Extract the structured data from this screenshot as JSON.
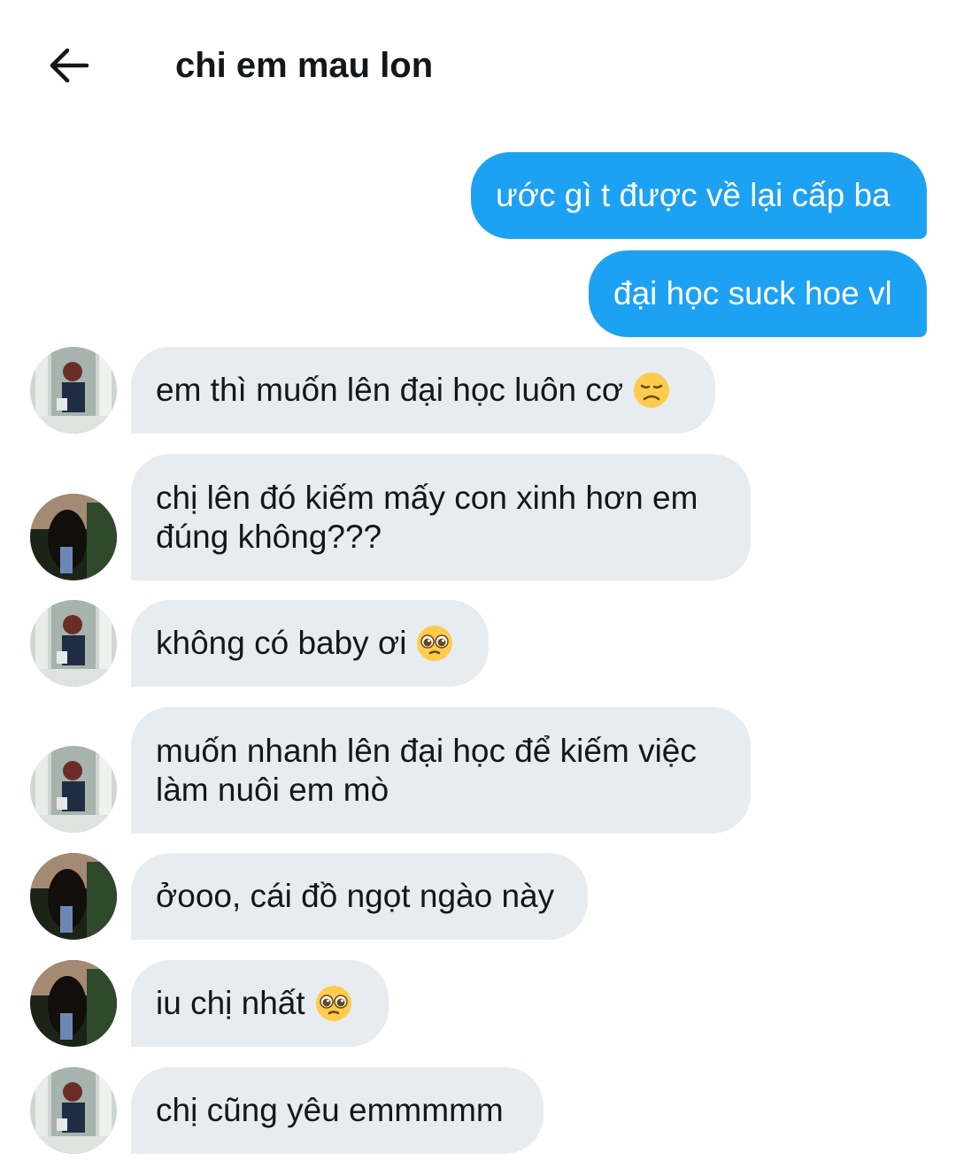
{
  "header": {
    "title": "chi em mau lon"
  },
  "messages": [
    {
      "text": "ước gì t được về lại cấp ba"
    },
    {
      "text": "đại học suck hoe vl"
    },
    {
      "text": "em thì muốn lên đại học luôn cơ",
      "emoji": "disappointed-face-emoji"
    },
    {
      "text": "chị lên đó kiếm mấy con xinh hơn em\nđúng không???"
    },
    {
      "text": "không có baby ơi",
      "emoji": "pleading-face-emoji"
    },
    {
      "text": "muốn nhanh lên đại học để kiếm việc\nlàm nuôi em mò"
    },
    {
      "text": "ởooo, cái đồ ngọt ngào này"
    },
    {
      "text": "iu chị nhất",
      "emoji": "pleading-face-emoji"
    },
    {
      "text": "chị cũng yêu emmmmm"
    }
  ],
  "colors": {
    "outgoing_bubble": "#1da1f2",
    "incoming_bubble": "#e6ecf0"
  }
}
